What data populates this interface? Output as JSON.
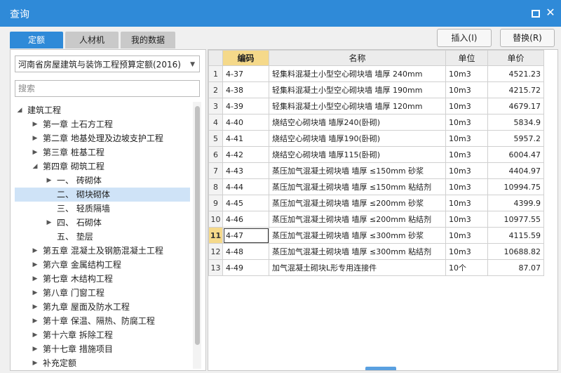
{
  "window": {
    "title": "查询"
  },
  "tabs": [
    {
      "label": "定额",
      "active": true
    },
    {
      "label": "人材机",
      "active": false
    },
    {
      "label": "我的数据",
      "active": false
    }
  ],
  "actions": {
    "insert": "插入(I)",
    "replace": "替换(R)"
  },
  "library": {
    "selected": "河南省房屋建筑与装饰工程预算定额(2016)"
  },
  "search": {
    "placeholder": "搜索"
  },
  "tree": [
    {
      "label": "建筑工程",
      "expanded": true
    },
    {
      "label": "第一章 土石方工程"
    },
    {
      "label": "第二章 地基处理及边坡支护工程"
    },
    {
      "label": "第三章 桩基工程"
    },
    {
      "label": "第四章 砌筑工程",
      "expanded": true
    },
    {
      "label": "一、 砖砌体"
    },
    {
      "label": "二、 砌块砌体",
      "selected": true
    },
    {
      "label": "三、 轻质隔墙"
    },
    {
      "label": "四、 石砌体"
    },
    {
      "label": "五、 垫层"
    },
    {
      "label": "第五章 混凝土及钢筋混凝土工程"
    },
    {
      "label": "第六章 金属结构工程"
    },
    {
      "label": "第七章 木结构工程"
    },
    {
      "label": "第八章 门窗工程"
    },
    {
      "label": "第九章 屋面及防水工程"
    },
    {
      "label": "第十章 保温、隔热、防腐工程"
    },
    {
      "label": "第十六章 拆除工程"
    },
    {
      "label": "第十七章 措施项目"
    },
    {
      "label": "补充定额"
    }
  ],
  "grid": {
    "headers": {
      "code": "编码",
      "name": "名称",
      "unit": "单位",
      "price": "单价"
    },
    "rows": [
      {
        "n": "1",
        "code": "4-37",
        "name": "轻集料混凝土小型空心砌块墙 墙厚 240mm",
        "unit": "10m3",
        "price": "4521.23"
      },
      {
        "n": "2",
        "code": "4-38",
        "name": "轻集料混凝土小型空心砌块墙 墙厚 190mm",
        "unit": "10m3",
        "price": "4215.72"
      },
      {
        "n": "3",
        "code": "4-39",
        "name": "轻集料混凝土小型空心砌块墙 墙厚 120mm",
        "unit": "10m3",
        "price": "4679.17"
      },
      {
        "n": "4",
        "code": "4-40",
        "name": "烧结空心砌块墙 墙厚240(卧砌)",
        "unit": "10m3",
        "price": "5834.9"
      },
      {
        "n": "5",
        "code": "4-41",
        "name": "烧结空心砌块墙 墙厚190(卧砌)",
        "unit": "10m3",
        "price": "5957.2"
      },
      {
        "n": "6",
        "code": "4-42",
        "name": "烧结空心砌块墙 墙厚115(卧砌)",
        "unit": "10m3",
        "price": "6004.47"
      },
      {
        "n": "7",
        "code": "4-43",
        "name": "蒸压加气混凝土砌块墙 墙厚 ≤150mm 砂浆",
        "unit": "10m3",
        "price": "4404.97"
      },
      {
        "n": "8",
        "code": "4-44",
        "name": "蒸压加气混凝土砌块墙 墙厚 ≤150mm 粘结剂",
        "unit": "10m3",
        "price": "10994.75"
      },
      {
        "n": "9",
        "code": "4-45",
        "name": "蒸压加气混凝土砌块墙 墙厚 ≤200mm 砂浆",
        "unit": "10m3",
        "price": "4399.9"
      },
      {
        "n": "10",
        "code": "4-46",
        "name": "蒸压加气混凝土砌块墙 墙厚 ≤200mm 粘结剂",
        "unit": "10m3",
        "price": "10977.55"
      },
      {
        "n": "11",
        "code": "4-47",
        "name": "蒸压加气混凝土砌块墙 墙厚 ≤300mm 砂浆",
        "unit": "10m3",
        "price": "4115.59",
        "active": true
      },
      {
        "n": "12",
        "code": "4-48",
        "name": "蒸压加气混凝土砌块墙 墙厚 ≤300mm 粘结剂",
        "unit": "10m3",
        "price": "10688.82"
      },
      {
        "n": "13",
        "code": "4-49",
        "name": "加气混凝土砌块L形专用连接件",
        "unit": "10个",
        "price": "87.07"
      }
    ]
  },
  "colors": {
    "accent": "#2f8ad8",
    "selection": "#cfe3f7",
    "highlight": "#f5d98a"
  }
}
